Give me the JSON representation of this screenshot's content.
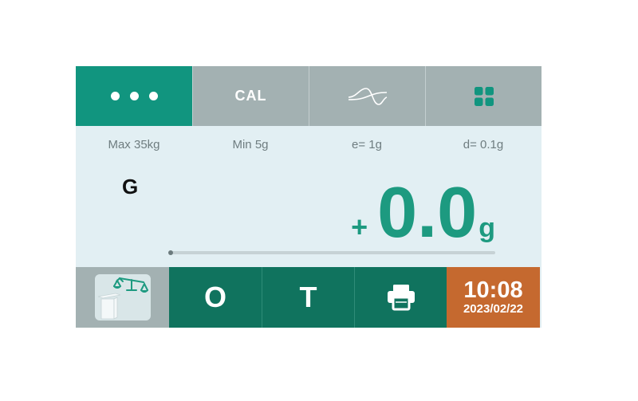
{
  "topbar": {
    "menu_icon": "more-dots-icon",
    "cal_label": "CAL",
    "filter_icon": "wave-filter-icon",
    "apps_icon": "grid-apps-icon"
  },
  "specs": {
    "max": "Max 35kg",
    "min": "Min 5g",
    "e": "e= 1g",
    "d": "d= 0.1g"
  },
  "display": {
    "mode": "G",
    "sign": "+",
    "value": "0.0",
    "unit": "g"
  },
  "bottombar": {
    "scale_icon": "weighing-scale-icon",
    "zero_label": "O",
    "tare_label": "T",
    "print_icon": "printer-icon",
    "time": "10:08",
    "date": "2023/02/22"
  },
  "colors": {
    "active_tab": "#11957f",
    "inactive_tab": "#a3b1b2",
    "screen_bg": "#e2eff3",
    "reading": "#1d9a80",
    "key_bg": "#10735e",
    "clock_bg": "#c5692f"
  }
}
